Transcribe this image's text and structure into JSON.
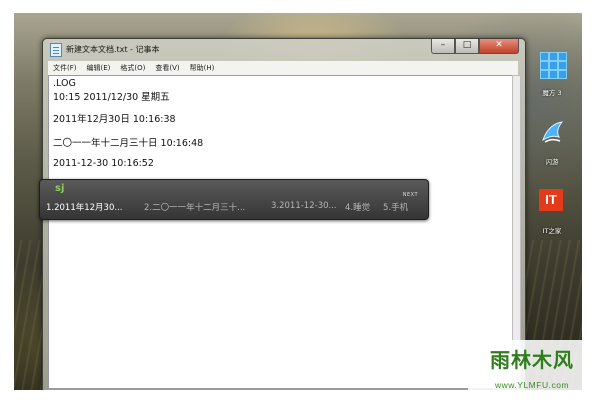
{
  "window": {
    "title": "新建文本文档.txt - 记事本",
    "controls": {
      "minimize": "–",
      "maximize": "□",
      "close": "✕"
    }
  },
  "menu": {
    "items": [
      "文件(F)",
      "编辑(E)",
      "格式(O)",
      "查看(V)",
      "帮助(H)"
    ]
  },
  "document": {
    "lines": [
      ".LOG",
      "10:15 2011/12/30 星期五",
      "2011年12月30日 10:16:38",
      "二〇一一年十二月三十日 10:16:48",
      "2011-12-30 10:16:52"
    ]
  },
  "ime": {
    "logo": "sj",
    "next_label": "NEXT",
    "candidates": [
      "1.2011年12月30...",
      "2.二〇一一年十二月三十...",
      "3.2011-12-30...",
      "4.睡觉",
      "5.手机"
    ]
  },
  "desktop_icons": [
    {
      "label": "魔方 3",
      "icon": "rubik-cube-icon"
    },
    {
      "label": "闪游",
      "icon": "flash-wing-icon"
    },
    {
      "label": "IT之家",
      "icon": "ithome-logo-icon",
      "glyph": "IT"
    }
  ],
  "watermark": {
    "title": "雨林木风",
    "url": "www.YLMFU.com"
  },
  "colors": {
    "ime_selected": "#ffffff",
    "ime_candidates": "#b5b5b5",
    "watermark_green": "#2f7d1c",
    "ithome_red": "#e43a1c"
  }
}
